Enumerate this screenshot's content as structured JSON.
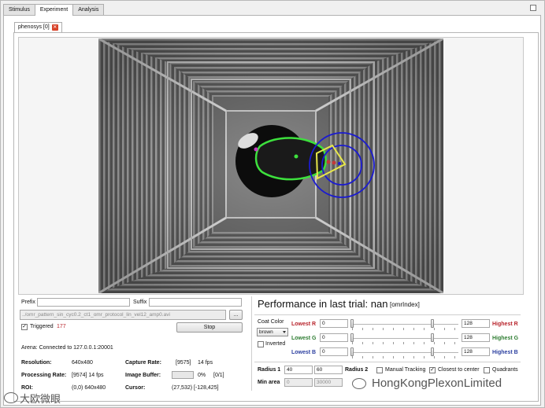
{
  "tabs": {
    "main": [
      "Stimulus",
      "Experiment",
      "Analysis"
    ],
    "active_index": 1,
    "sub_tab_label": "phenosys [0]"
  },
  "video": {
    "tracking_colors": {
      "body_outline": "#3de03d",
      "circle": "#1b1bd0",
      "head_marker": "#e8e84a",
      "point": "#c23838"
    }
  },
  "recording": {
    "prefix_label": "Prefix",
    "prefix_value": "",
    "suffix_label": "Suffix",
    "suffix_value": "",
    "file_path": "../omr_pattern_sin_cyc0.2_ct1_omr_protocol_lin_vel12_amp0.avi",
    "browse_label": "...",
    "triggered_label": "Triggered",
    "triggered_checked": true,
    "trigger_count": "177",
    "stop_label": "Stop"
  },
  "status": {
    "arena": "Arena: Connected to 127.0.0.1:20001",
    "resolution_label": "Resolution:",
    "resolution_value": "640x480",
    "capture_rate_label": "Capture Rate:",
    "capture_rate_value": "[9575]",
    "capture_fps": "14 fps",
    "processing_rate_label": "Processing Rate:",
    "processing_rate_value": "[9574] 14 fps",
    "image_buffer_label": "Image Buffer:",
    "image_buffer_percent": "0%",
    "image_buffer_count": "[0/1]",
    "roi_label": "ROI:",
    "roi_value": "(0,0) 640x480",
    "cursor_label": "Cursor:",
    "cursor_value": "(27,532) [-128,425]"
  },
  "performance": {
    "title": "Performance in last trial: nan",
    "index_label": "[omrIndex]",
    "coat_color_label": "Coat Color",
    "coat_color_value": "brown",
    "inverted_label": "Inverted",
    "inverted_checked": false,
    "lowest_r_label": "Lowest R",
    "lowest_r_value": "0",
    "highest_r_label": "Highest R",
    "highest_r_value": "128",
    "lowest_g_label": "Lowest G",
    "lowest_g_value": "0",
    "highest_g_label": "Highest G",
    "highest_g_value": "128",
    "lowest_b_label": "Lowest B",
    "lowest_b_value": "0",
    "highest_b_label": "Highest B",
    "highest_b_value": "128",
    "radius1_label": "Radius 1",
    "radius1_value": "40",
    "radius1_value2": "60",
    "radius2_label": "Radius 2",
    "manual_tracking_label": "Manual Tracking",
    "manual_tracking_checked": false,
    "closest_center_label": "Closest to center",
    "closest_center_checked": true,
    "quadrants_label": "Quadrants",
    "quadrants_checked": false,
    "min_area_label": "Min area",
    "min_area_value": "0",
    "max_area_value": "30000"
  },
  "watermarks": {
    "left_text": "大欧微眼",
    "right_text": "HongKongPlexonLimited"
  }
}
